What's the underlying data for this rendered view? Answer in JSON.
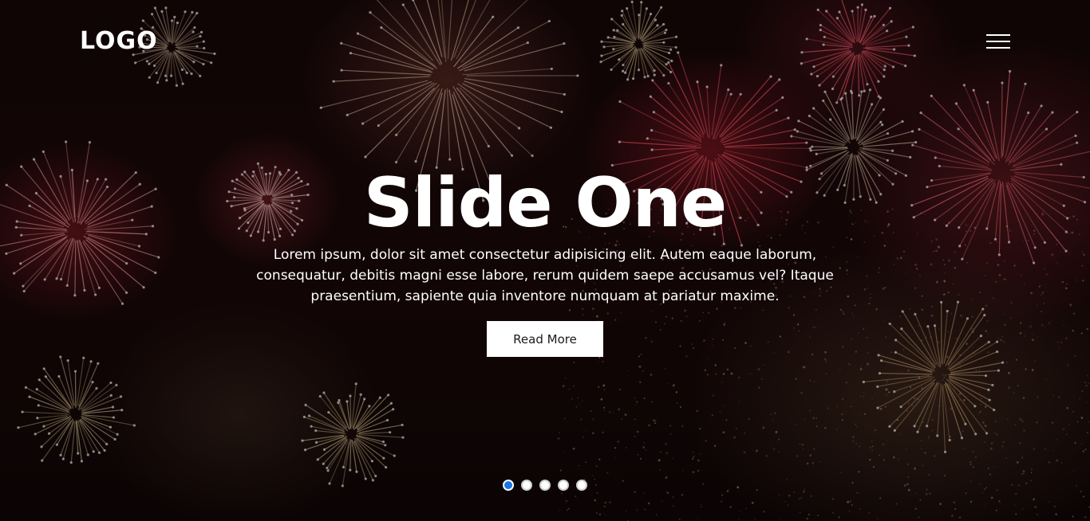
{
  "navbar": {
    "logo": "LOGO",
    "menu_icon": "hamburger-menu-icon"
  },
  "slide": {
    "title": "Slide One",
    "text": "Lorem ipsum, dolor sit amet consectetur adipisicing elit. Autem eaque laborum, consequatur, debitis magni esse labore, rerum quidem saepe accusamus vel? Itaque praesentium, sapiente quia inventore numquam at pariatur maxime.",
    "button_label": "Read More"
  },
  "pagination": {
    "total": 5,
    "active_index": 0,
    "active_color": "#1a73e8"
  },
  "background": {
    "description_icon": "fireworks-background",
    "colors": [
      "#160708",
      "#a31e2d",
      "#c8a070"
    ]
  }
}
